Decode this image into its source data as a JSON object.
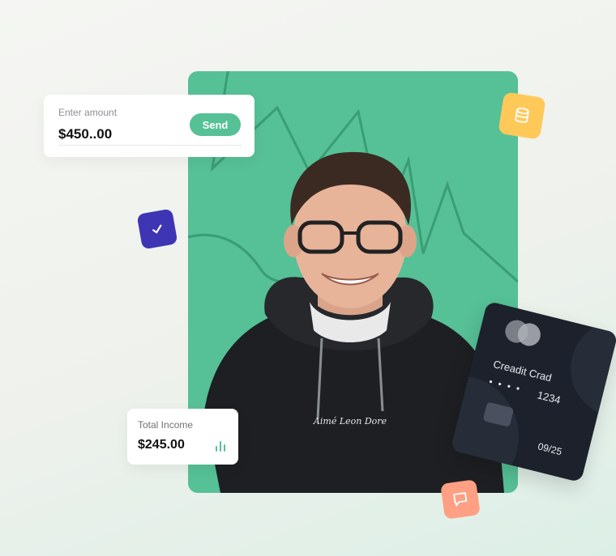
{
  "amount_card": {
    "label": "Enter amount",
    "value": "$450..00",
    "send_label": "Send"
  },
  "income_card": {
    "label": "Total Income",
    "value": "$245.00"
  },
  "credit_card": {
    "title": "Creadit Crad",
    "dots": "• • • •",
    "last4": "1234",
    "expiry": "09/25"
  },
  "hoodie_text": "Aimé Leon Dore",
  "icons": {
    "check": "check-icon",
    "database": "database-icon",
    "chat": "chat-icon",
    "bar_chart": "bar-chart-icon",
    "card_brand": "card-brand-logo"
  },
  "colors": {
    "accent_green": "#56c096",
    "check_tile": "#3e35b4",
    "database_tile": "#ffc95a",
    "chat_tile": "#ff9f83",
    "card_bg": "#1c212b"
  }
}
